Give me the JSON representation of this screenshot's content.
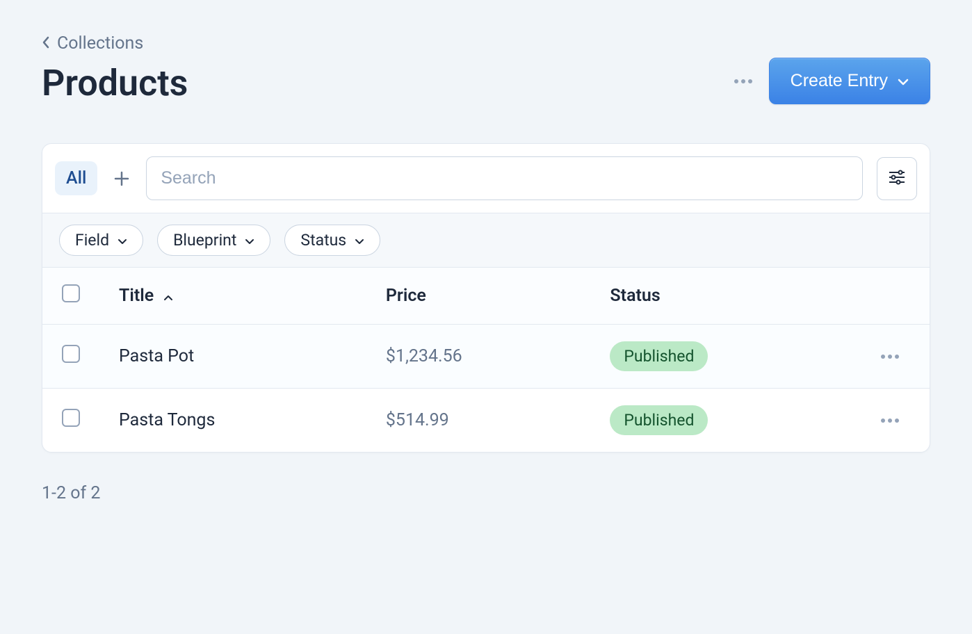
{
  "breadcrumb": {
    "label": "Collections"
  },
  "page": {
    "title": "Products"
  },
  "header": {
    "create_label": "Create Entry"
  },
  "toolbar": {
    "all_label": "All",
    "search_placeholder": "Search"
  },
  "filters": [
    {
      "label": "Field"
    },
    {
      "label": "Blueprint"
    },
    {
      "label": "Status"
    }
  ],
  "table": {
    "columns": {
      "title": "Title",
      "price": "Price",
      "status": "Status"
    },
    "rows": [
      {
        "title": "Pasta Pot",
        "price": "$1,234.56",
        "status": "Published"
      },
      {
        "title": "Pasta Tongs",
        "price": "$514.99",
        "status": "Published"
      }
    ]
  },
  "pagination": {
    "text": "1-2 of 2"
  }
}
